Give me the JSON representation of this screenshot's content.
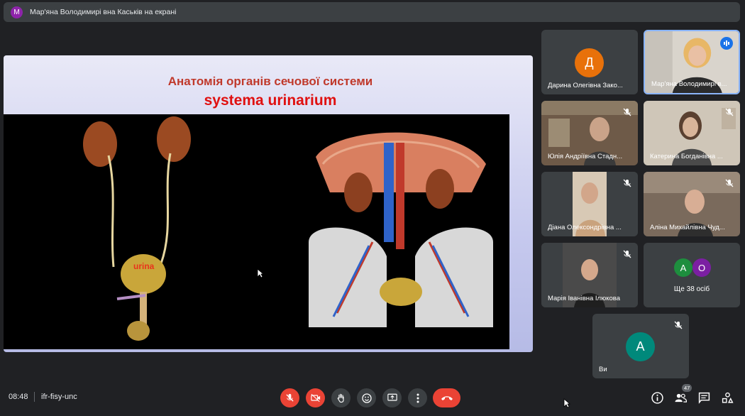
{
  "banner": {
    "avatar_letter": "M",
    "text": "Мар'яна Володимирі вна Каськів на екрані"
  },
  "slide": {
    "title_line1": "Анатомія органів сечової системи",
    "title_line2": "systema urinarium",
    "label": "urina"
  },
  "participants": [
    {
      "name": "Дарина Олегівна Зако...",
      "avatar_letter": "Д",
      "avatar_color": "#e8710a"
    },
    {
      "name": "Мар'яна Володимирі в..."
    },
    {
      "name": "Юлія Андріївна Стадн..."
    },
    {
      "name": "Катерина Богданівна ..."
    },
    {
      "name": "Діана Олексондрівна ..."
    },
    {
      "name": "Аліна Михайлівна Чуд..."
    },
    {
      "name": "Марія Іванівна Ілюкова"
    },
    {
      "name": "Ви",
      "avatar_letter": "А",
      "avatar_color": "#00897b"
    }
  ],
  "more": {
    "avatar1": "А",
    "avatar1_color": "#1e8e3e",
    "avatar2": "О",
    "avatar2_color": "#7b1fa2",
    "label": "Ще 38 осіб"
  },
  "bottom": {
    "time": "08:48",
    "meeting_code": "ifr-fisy-unc",
    "people_count": "47"
  }
}
